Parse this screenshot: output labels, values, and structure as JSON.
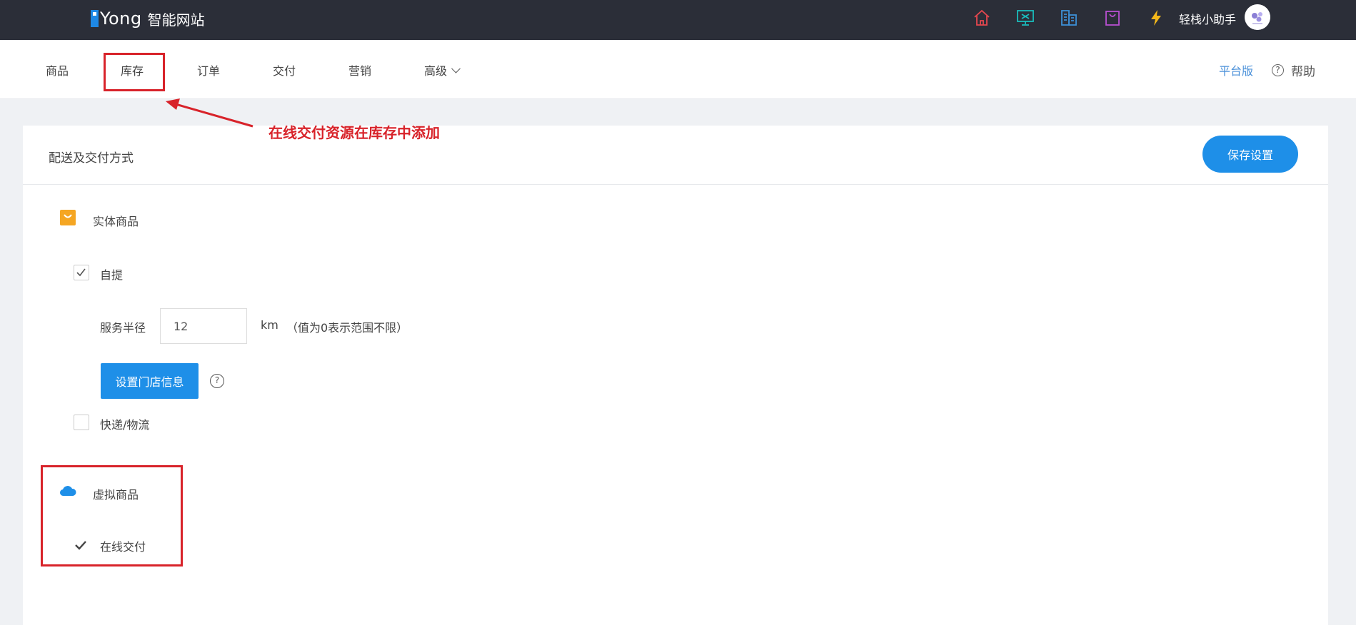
{
  "topbar": {
    "logo_en": "Yong",
    "logo_cn": "智能网站",
    "user_name": "轻栈小助手",
    "icons": [
      "home-icon",
      "monitor-icon",
      "building-icon",
      "bag-icon",
      "lightning-icon"
    ],
    "icon_colors": [
      "#e5474f",
      "#1abcbc",
      "#3d8fd6",
      "#b94fd1",
      "#f4b81a"
    ]
  },
  "nav": {
    "items": [
      "商品",
      "库存",
      "订单",
      "交付",
      "营销",
      "高级"
    ],
    "platform": "平台版",
    "help": "帮助"
  },
  "annotation": {
    "text": "在线交付资源在库存中添加",
    "color": "#d8232a"
  },
  "card": {
    "title": "配送及交付方式",
    "save_button": "保存设置",
    "physical": {
      "label": "实体商品",
      "self_pickup": {
        "label": "自提",
        "checked": true
      },
      "radius_label": "服务半径",
      "radius_value": "12",
      "unit": "km",
      "hint": "（值为0表示范围不限）",
      "store_button": "设置门店信息",
      "express": {
        "label": "快递/物流",
        "checked": false
      }
    },
    "virtual": {
      "label": "虚拟商品",
      "online": {
        "label": "在线交付",
        "checked": true
      }
    }
  },
  "colors": {
    "accent": "#1e8fe8",
    "topbar_bg": "#2b2e38",
    "highlight": "#d8232a"
  }
}
